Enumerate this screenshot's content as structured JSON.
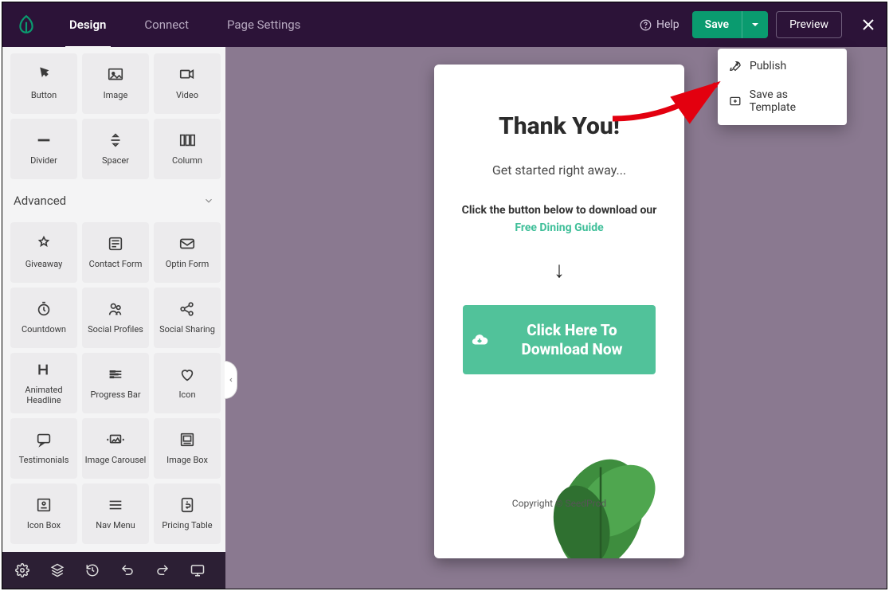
{
  "tabs": {
    "design": "Design",
    "connect": "Connect",
    "settings": "Page Settings"
  },
  "top": {
    "help": "Help",
    "save": "Save",
    "preview": "Preview"
  },
  "dropdown": {
    "publish": "Publish",
    "save_template": "Save as Template"
  },
  "basic_blocks": [
    {
      "id": "button",
      "label": "Button"
    },
    {
      "id": "image",
      "label": "Image"
    },
    {
      "id": "video",
      "label": "Video"
    },
    {
      "id": "divider",
      "label": "Divider"
    },
    {
      "id": "spacer",
      "label": "Spacer"
    },
    {
      "id": "column",
      "label": "Column"
    }
  ],
  "advanced_title": "Advanced",
  "adv_blocks": [
    {
      "id": "giveaway",
      "label": "Giveaway"
    },
    {
      "id": "contact-form",
      "label": "Contact Form"
    },
    {
      "id": "optin-form",
      "label": "Optin Form"
    },
    {
      "id": "countdown",
      "label": "Countdown"
    },
    {
      "id": "social-profiles",
      "label": "Social Profiles"
    },
    {
      "id": "social-sharing",
      "label": "Social Sharing"
    },
    {
      "id": "animated-headline",
      "label": "Animated\nHeadline"
    },
    {
      "id": "progress-bar",
      "label": "Progress Bar"
    },
    {
      "id": "icon",
      "label": "Icon"
    },
    {
      "id": "testimonials",
      "label": "Testimonials"
    },
    {
      "id": "image-carousel",
      "label": "Image Carousel"
    },
    {
      "id": "image-box",
      "label": "Image Box"
    },
    {
      "id": "icon-box",
      "label": "Icon Box"
    },
    {
      "id": "nav-menu",
      "label": "Nav Menu"
    },
    {
      "id": "pricing-table",
      "label": "Pricing Table"
    }
  ],
  "preview": {
    "title": "Thank You!",
    "subtitle": "Get started right away...",
    "instruction1": "Click the button below to download our",
    "instruction_link": "Free Dining Guide",
    "arrow": "↓",
    "cta": "Click Here To Download Now",
    "copyright": "Copyright © SeedProd"
  }
}
